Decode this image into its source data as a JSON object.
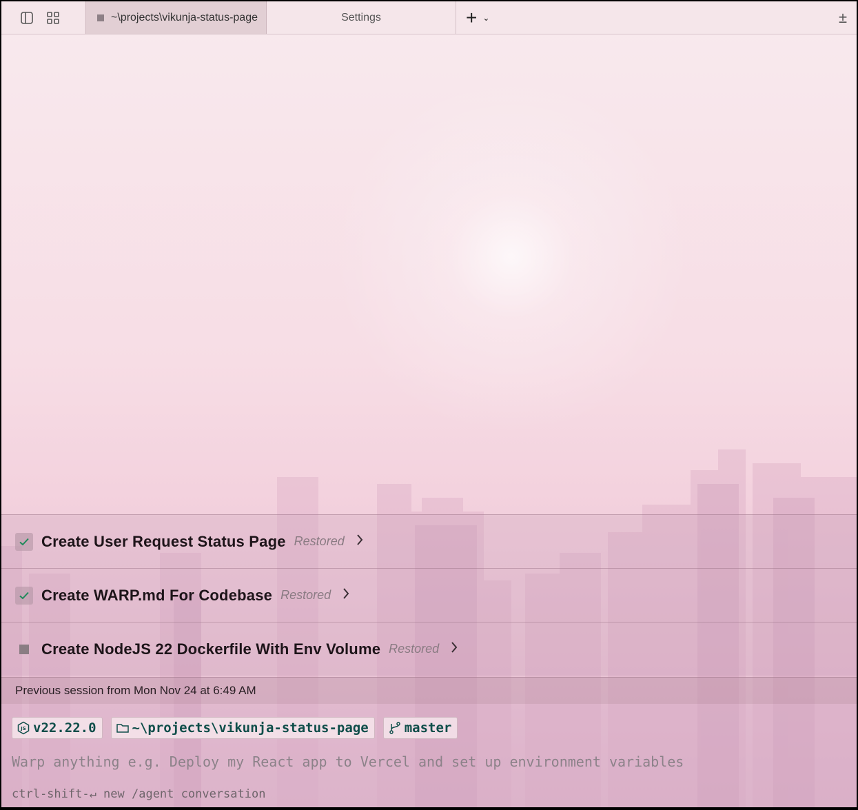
{
  "tabbar": {
    "active_tab_label": "~\\projects\\vikunja-status-page",
    "settings_tab_label": "Settings",
    "new_tab_glyph": "+",
    "dropdown_glyph": "⌄",
    "right_glyph": "±"
  },
  "blocks": [
    {
      "title": "Create User Request Status Page",
      "status": "Restored",
      "state": "done"
    },
    {
      "title": "Create WARP.md For Codebase",
      "status": "Restored",
      "state": "done"
    },
    {
      "title": "Create NodeJS 22 Dockerfile With Env Volume",
      "status": "Restored",
      "state": "pending"
    }
  ],
  "session": {
    "label": "Previous session from Mon Nov 24 at 6:49 AM"
  },
  "context_chips": {
    "node_version": "v22.22.0",
    "directory": "~\\projects\\vikunja-status-page",
    "branch": "master"
  },
  "input": {
    "placeholder": "Warp anything e.g. Deploy my React app to Vercel and set up environment variables",
    "hint": "ctrl-shift-↵ new /agent conversation"
  },
  "colors": {
    "accent_teal": "#0f4e4a",
    "check_green": "#1f8a5a"
  }
}
